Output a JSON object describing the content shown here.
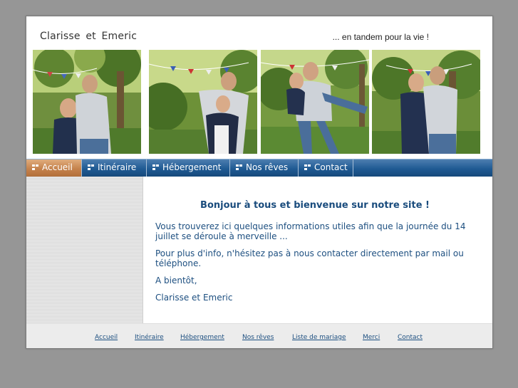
{
  "header": {
    "brand": "Clarisse  et  Emeric",
    "tagline": "... en tandem pour la vie !"
  },
  "photos": [
    {
      "name": "couple-photo-1"
    },
    {
      "name": "couple-photo-2"
    },
    {
      "name": "couple-photo-3"
    },
    {
      "name": "couple-photo-4"
    }
  ],
  "nav": {
    "items": [
      {
        "label": "Accueil",
        "active": true
      },
      {
        "label": "Itinéraire",
        "active": false
      },
      {
        "label": "Hébergement",
        "active": false
      },
      {
        "label": "Nos rêves",
        "active": false
      },
      {
        "label": "Contact",
        "active": false
      }
    ],
    "icon": "menu-squares-icon"
  },
  "content": {
    "welcome": "Bonjour à tous et bienvenue sur notre site !",
    "paragraphs": [
      "Vous trouverez ici quelques informations utiles afin que la journée du 14 juillet se déroule à merveille ...",
      "Pour plus d'info, n'hésitez pas à nous contacter directement par mail ou téléphone.",
      "A bientôt,",
      "Clarisse et Emeric"
    ]
  },
  "footer": {
    "links": [
      "Accueil",
      "Itinéraire",
      "Hébergement",
      "Nos rêves",
      "Liste de mariage",
      "Merci",
      "Contact"
    ]
  },
  "colors": {
    "background": "#969696",
    "nav_blue": "#1f5a93",
    "nav_active": "#c5824c",
    "text_blue": "#1d4f80"
  }
}
